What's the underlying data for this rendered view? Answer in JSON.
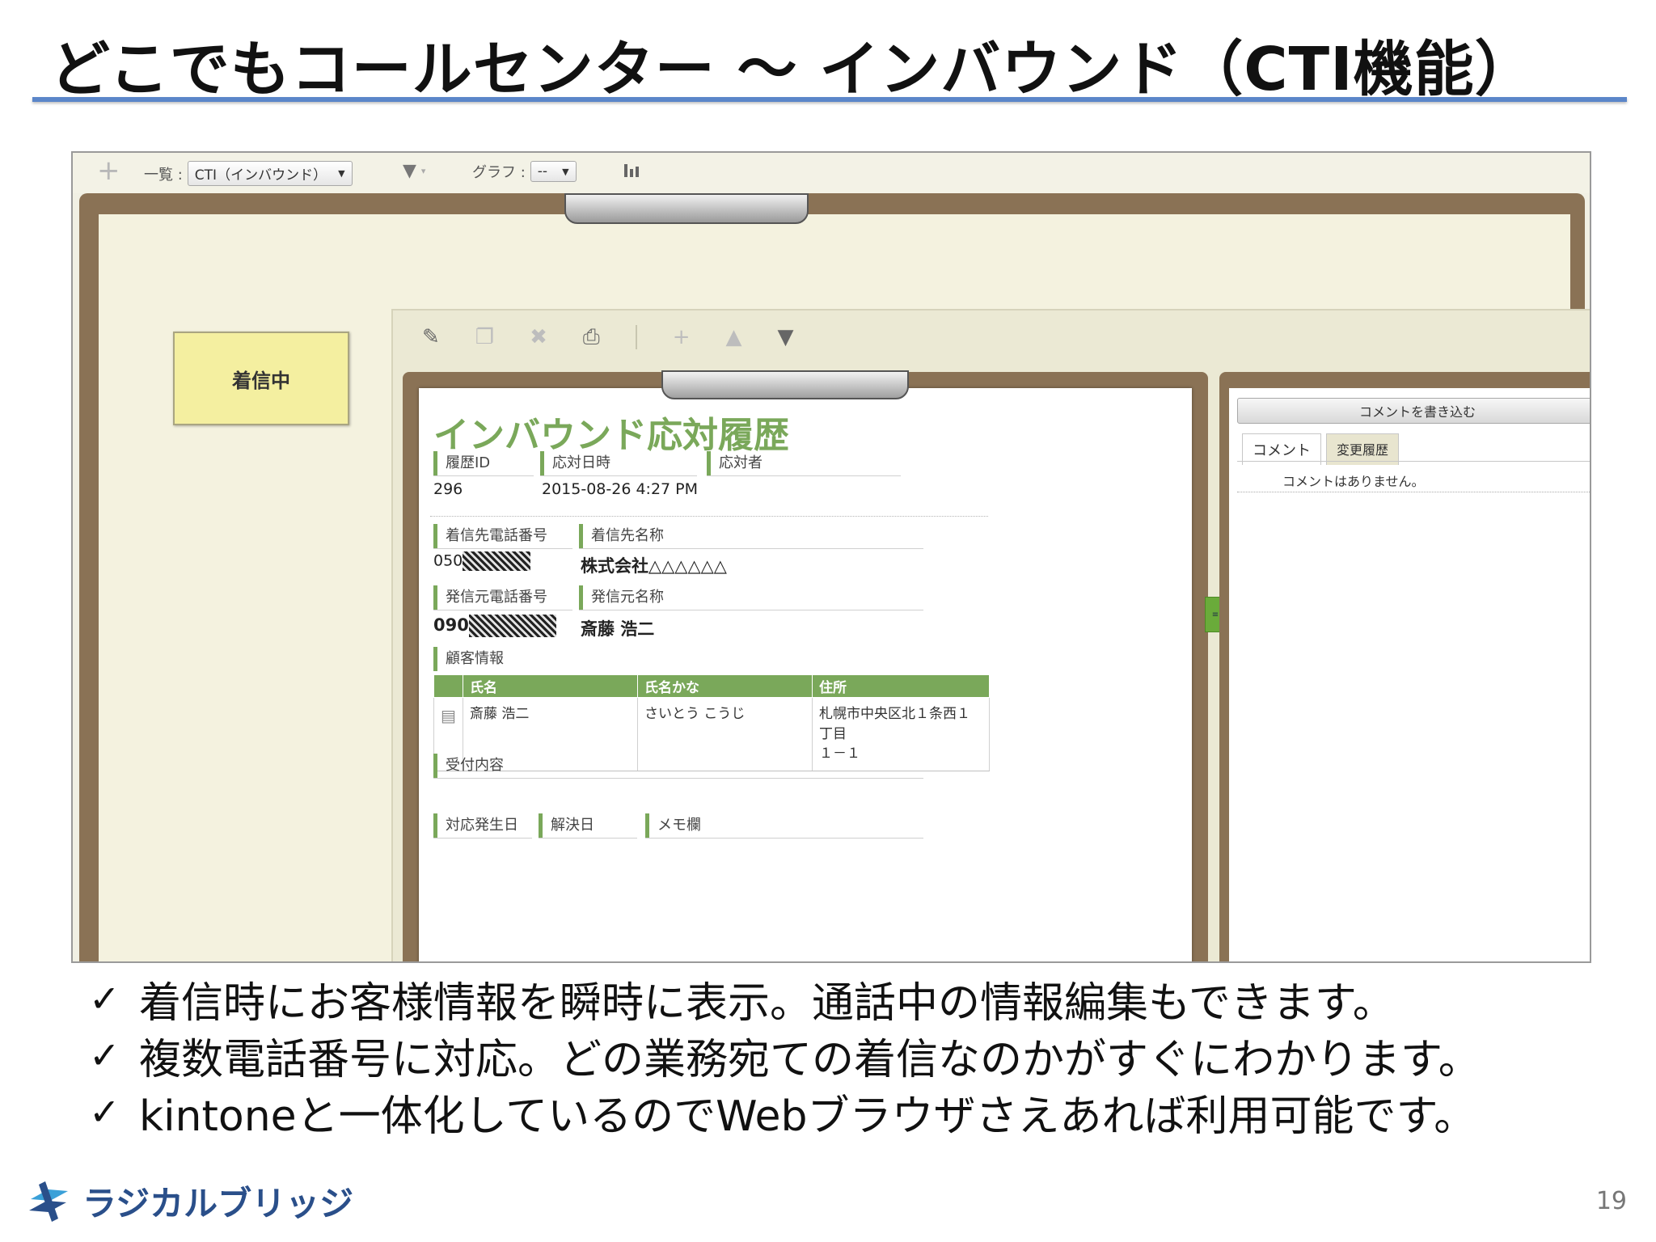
{
  "slide": {
    "title": "どこでもコールセンター ～ インバウンド（CTI機能）",
    "page_number": "19",
    "logo_text": "ラジカルブリッジ",
    "bullets": [
      "着信時にお客様情報を瞬時に表示。通話中の情報編集もできます。",
      "複数電話番号に対応。どの業務宛ての着信なのかがすぐにわかります。",
      "kintoneと一体化しているのでWebブラウザさえあれば利用可能です。"
    ],
    "check_mark": "✓"
  },
  "toolbar": {
    "add_icon": "+",
    "list_label": "一覧 :",
    "list_value": "CTI（インバウンド）",
    "graph_label": "グラフ :",
    "graph_value": "--"
  },
  "incoming_button": {
    "label": "着信中"
  },
  "record": {
    "title": "インバウンド応対履歴",
    "fields": {
      "history_id": {
        "label": "履歴ID",
        "value": "296"
      },
      "datetime": {
        "label": "応対日時",
        "value": "2015-08-26 4:27 PM"
      },
      "responder": {
        "label": "応対者",
        "value": ""
      },
      "dest_phone": {
        "label": "着信先電話番号",
        "value": "050"
      },
      "dest_name": {
        "label": "着信先名称",
        "value": "株式会社△△△△△△"
      },
      "src_phone": {
        "label": "発信元電話番号",
        "value": "090"
      },
      "src_name": {
        "label": "発信元名称",
        "value": "斎藤 浩二"
      },
      "customer_info": {
        "label": "顧客情報"
      },
      "reception": {
        "label": "受付内容"
      },
      "occur_date": {
        "label": "対応発生日"
      },
      "resolve_date": {
        "label": "解決日"
      },
      "memo": {
        "label": "メモ欄"
      }
    },
    "customer_table": {
      "headers": [
        "氏名",
        "氏名かな",
        "住所"
      ],
      "rows": [
        {
          "name": "斎藤 浩二",
          "kana": "さいとう こうじ",
          "address_line1": "札幌市中央区北１条西１丁目",
          "address_line2": "１－１"
        }
      ]
    }
  },
  "side": {
    "comment_button": "コメントを書き込む",
    "tab_comment": "コメント",
    "tab_history": "変更履歴",
    "empty_text": "コメントはありません。"
  },
  "colors": {
    "accent_green": "#7aa85a",
    "board_brown": "#8a7255",
    "title_rule_blue": "#5b86c9",
    "incoming_yellow": "#f4efa0"
  }
}
